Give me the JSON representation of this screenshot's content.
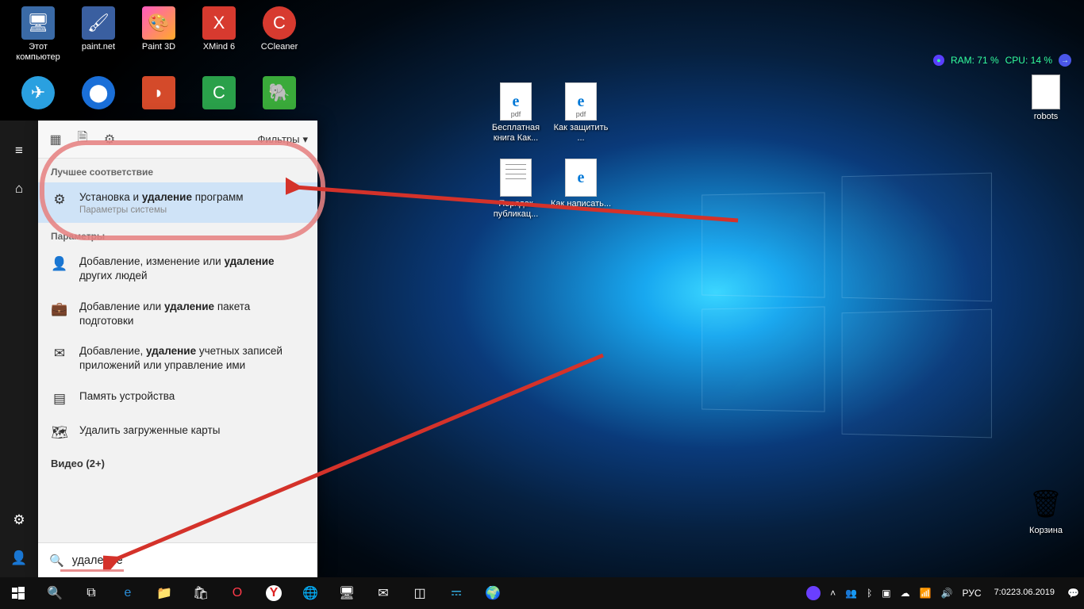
{
  "desktop_icons_row1": [
    {
      "label": "Этот\nкомпьютер",
      "color": "#3a77b5"
    },
    {
      "label": "paint.net",
      "color": "#3a5fa0"
    },
    {
      "label": "Paint 3D",
      "color": "#e85ab5"
    },
    {
      "label": "XMind 6",
      "color": "#d73a2f"
    },
    {
      "label": "CCleaner",
      "color": "#d73a2f"
    }
  ],
  "desktop_icons_row2": [
    {
      "label": "",
      "color": "#2aa0e0"
    },
    {
      "label": "",
      "color": "#1a6fd8"
    },
    {
      "label": "",
      "color": "#d44a2a"
    },
    {
      "label": "",
      "color": "#2aa04a"
    },
    {
      "label": "",
      "color": "#3aaa3a"
    }
  ],
  "files_row1": [
    {
      "label": "Бесплатная\nкнига Как..."
    },
    {
      "label": "Как\nзащитить ..."
    }
  ],
  "files_row2": [
    {
      "label": "Порядок\nпубликац..."
    },
    {
      "label": "Как\nнаписать..."
    }
  ],
  "robots_label": "robots",
  "recycle_label": "Корзина",
  "widget": {
    "ram": "RAM: 71 %",
    "cpu": "CPU: 14 %"
  },
  "search": {
    "filters": "Фильтры",
    "best_header": "Лучшее соответствие",
    "params_header": "Параметры",
    "videos": "Видео (2+)",
    "query": "удаление",
    "best": {
      "pre": "Установка и ",
      "bold": "удаление",
      "post": " программ",
      "sub": "Параметры системы"
    },
    "items": [
      {
        "pre": "Добавление, изменение или ",
        "bold": "удаление",
        "post": "\nдругих людей",
        "icon": "person"
      },
      {
        "pre": "Добавление или ",
        "bold": "удаление",
        "post": " пакета\nподготовки",
        "icon": "briefcase"
      },
      {
        "pre": "Добавление, ",
        "bold": "удаление",
        "post": " учетных записей\nприложений или управление ими",
        "icon": "mail"
      },
      {
        "pre": "Память устройства",
        "bold": "",
        "post": "",
        "icon": "storage"
      },
      {
        "pre": "Удалить загруженные карты",
        "bold": "",
        "post": "",
        "icon": "map"
      }
    ]
  },
  "tray": {
    "lang": "РУС",
    "time": "7:02",
    "date": "23.06.2019"
  }
}
